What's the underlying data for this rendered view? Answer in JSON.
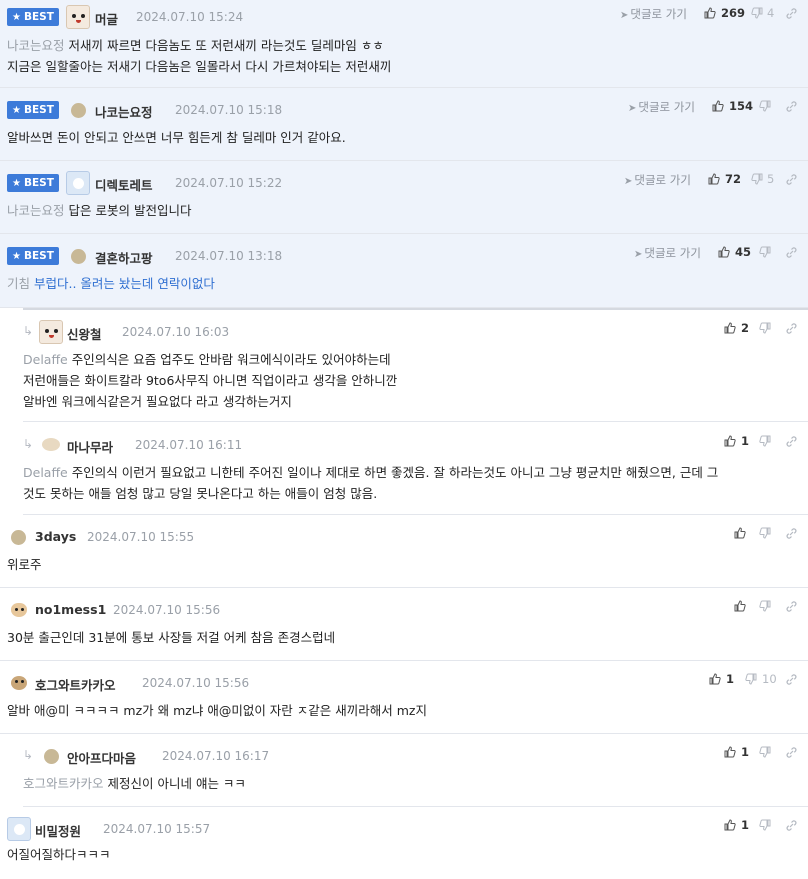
{
  "labels": {
    "best": "BEST",
    "reply_btn": "댓글로 가기"
  },
  "colors": {
    "best_bg": "#eef3fb",
    "badge": "#3d7bd9",
    "text_muted": "#9aa0a8"
  },
  "comments": [
    {
      "nick": "머글",
      "date": "2024.07.10 15:24",
      "up": "269",
      "down": "4",
      "mention": "나코는요정",
      "lines": [
        "저새끼 짜르면 다음놈도 또 저런새끼 라는것도 딜레마임 ㅎㅎ",
        "지금은 일할줄아는 저새기 다음놈은 일몰라서 다시 가르쳐야되는 저런새끼"
      ]
    },
    {
      "nick": "나코는요정",
      "date": "2024.07.10 15:18",
      "up": "154",
      "down": "",
      "mention": "",
      "lines": [
        "알바쓰면 돈이 안되고 안쓰면 너무 힘든게 참 딜레마 인거 같아요."
      ]
    },
    {
      "nick": "디렉토레트",
      "date": "2024.07.10 15:22",
      "up": "72",
      "down": "5",
      "mention": "나코는요정",
      "lines": [
        "답은 로봇의 발전입니다"
      ]
    },
    {
      "nick": "결혼하고팡",
      "date": "2024.07.10 13:18",
      "up": "45",
      "down": "",
      "mention": "기침",
      "lines": [
        "부럽다.. 올려는 놨는데 연락이없다"
      ]
    },
    {
      "nick": "신왕철",
      "date": "2024.07.10 16:03",
      "up": "2",
      "down": "",
      "mention": "Delaffe",
      "lines": [
        "주인의식은 요즘 업주도 안바람 워크에식이라도 있어야하는데",
        "저런애들은 화이트칼라 9to6사무직 아니면 직업이라고 생각을 안하니깐",
        "알바엔 워크에식같은거 필요없다 라고 생각하는거지"
      ]
    },
    {
      "nick": "마나무라",
      "date": "2024.07.10 16:11",
      "up": "1",
      "down": "",
      "mention": "Delaffe",
      "lines": [
        "주인의식 이런거 필요없고 니한테 주어진 일이나 제대로 하면 좋겠음. 잘 하라는것도 아니고 그냥 평균치만 해줬으면, 근데 그",
        "것도 못하는 애들 엄청 많고 당일 못나온다고 하는 애들이 엄청 많음."
      ]
    },
    {
      "nick": "3days",
      "date": "2024.07.10 15:55",
      "up": "",
      "down": "",
      "mention": "",
      "lines": [
        "위로주"
      ]
    },
    {
      "nick": "no1mess1",
      "date": "2024.07.10 15:56",
      "up": "",
      "down": "",
      "mention": "",
      "lines": [
        "30분 출근인데 31분에 통보 사장들 저걸 어케 참음 존경스럽네"
      ]
    },
    {
      "nick": "호그와트카카오",
      "date": "2024.07.10 15:56",
      "up": "1",
      "down": "10",
      "mention": "",
      "lines": [
        "알바 애@미 ㅋㅋㅋㅋ mz가 왜 mz냐 애@미없이 자란 ㅈ같은 새끼라해서 mz지"
      ]
    },
    {
      "nick": "안아프다마음",
      "date": "2024.07.10 16:17",
      "up": "1",
      "down": "",
      "mention": "호그와트카카오",
      "lines": [
        "제정신이 아니네 얘는 ㅋㅋ"
      ]
    },
    {
      "nick": "비밀정원",
      "date": "2024.07.10 15:57",
      "up": "1",
      "down": "",
      "mention": "",
      "lines": [
        "어질어질하다ㅋㅋㅋ"
      ]
    }
  ]
}
